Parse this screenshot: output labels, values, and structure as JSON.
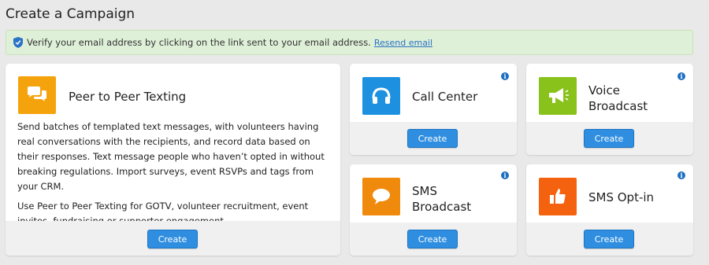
{
  "page": {
    "title": "Create a Campaign"
  },
  "alert": {
    "message": "Verify your email address by clicking on the link sent to your email address.",
    "link": "Resend email",
    "color": "#dff0d8"
  },
  "cards": {
    "p2p": {
      "title": "Peer to Peer Texting",
      "icon": "chat-bubbles-icon",
      "color": "#f5a30c",
      "description_1": "Send batches of templated text messages, with volunteers having real conversations with the recipients, and record data based on their responses. Text message people who haven’t opted in without breaking regulations. Import surveys, event RSVPs and tags from your CRM.",
      "description_2": "Use Peer to Peer Texting for GOTV, volunteer recruitment, event invites, fundraising or supporter engagement.",
      "button": "Create"
    },
    "call_center": {
      "title": "Call Center",
      "icon": "headset-icon",
      "color": "#1e90e0",
      "button": "Create",
      "info": "i"
    },
    "voice": {
      "title_line1": "Voice",
      "title_line2": "Broadcast",
      "icon": "megaphone-icon",
      "color": "#88c21a",
      "button": "Create",
      "info": "i"
    },
    "sms": {
      "title_line1": "SMS",
      "title_line2": "Broadcast",
      "icon": "speech-bubble-icon",
      "color": "#f08a0c",
      "button": "Create",
      "info": "i"
    },
    "optin": {
      "title": "SMS Opt-in",
      "icon": "thumbs-up-icon",
      "color": "#f5620f",
      "button": "Create",
      "info": "i"
    }
  },
  "colors": {
    "button": "#2f8ee0",
    "info": "#1f6fc1"
  }
}
